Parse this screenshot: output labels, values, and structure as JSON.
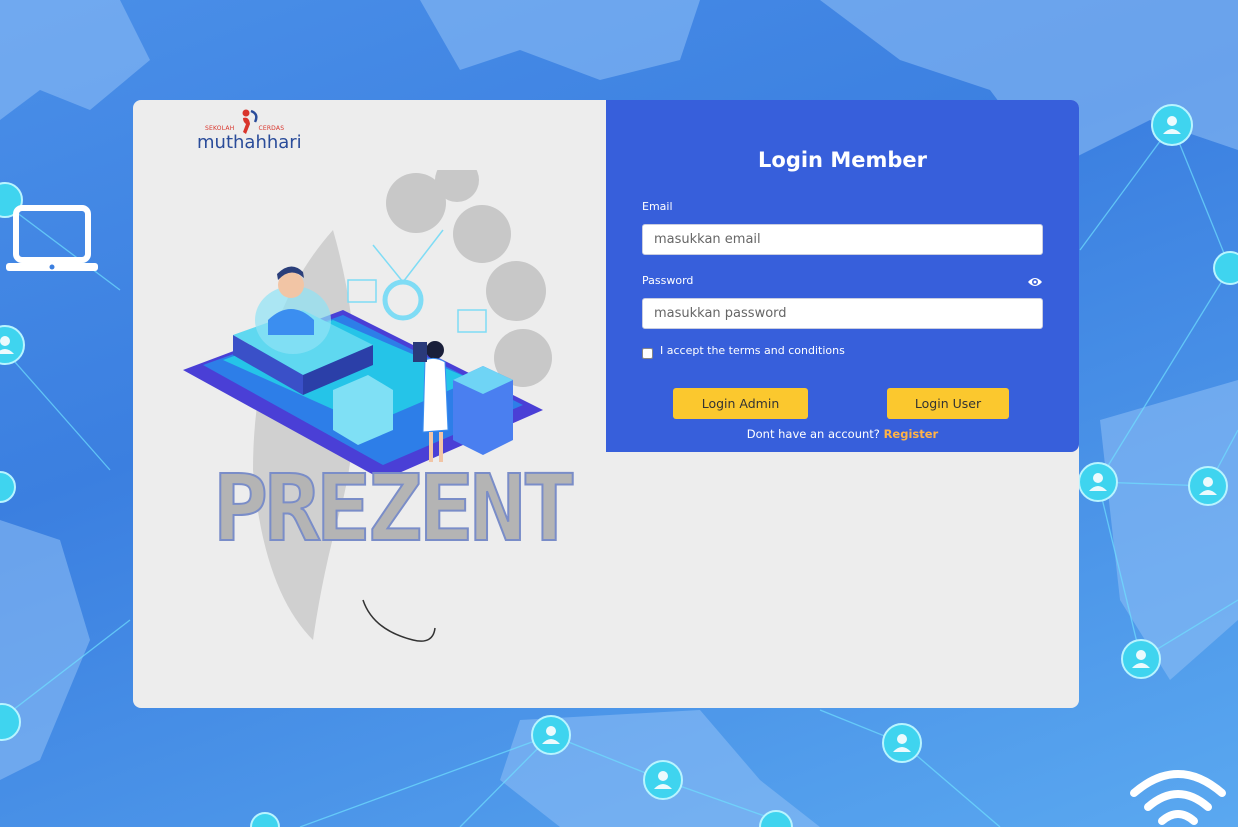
{
  "logo": {
    "top_left": "SEKOLAH",
    "top_right": "CERDAS",
    "name": "muthahhari"
  },
  "illustration": {
    "word": "PREZENT"
  },
  "form": {
    "title": "Login Member",
    "email_label": "Email",
    "email_placeholder": "masukkan email",
    "password_label": "Password",
    "password_placeholder": "masukkan password",
    "terms_label": "I accept the terms and conditions",
    "login_admin_label": "Login Admin",
    "login_user_label": "Login User",
    "register_prompt": "Dont have an account?",
    "register_link": "Register"
  },
  "colors": {
    "panel": "#375fdb",
    "button": "#fbc82e",
    "card": "#ededed",
    "background": "#3b7fe0",
    "register_link": "#ffb347"
  },
  "icons": [
    "laptop-icon",
    "wifi-icon",
    "user-node-icon",
    "eye-icon"
  ]
}
